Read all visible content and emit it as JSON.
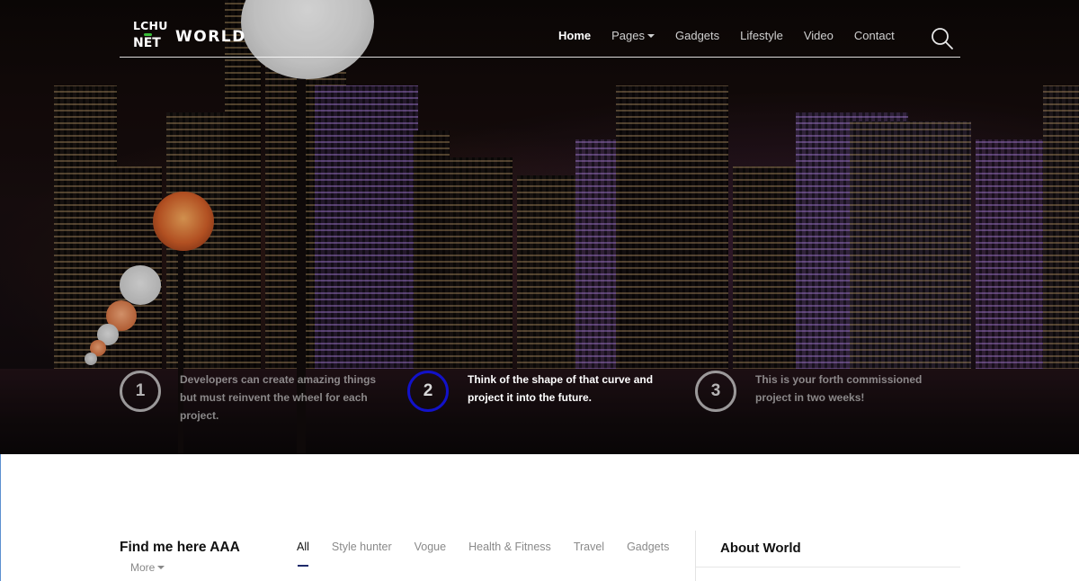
{
  "brand": {
    "logo_line1": "LCHU",
    "logo_line2": "NET",
    "name": "WORLD",
    "accent_color": "#3bbf3b"
  },
  "nav": {
    "items": [
      {
        "label": "Home",
        "active": true
      },
      {
        "label": "Pages",
        "dropdown": true
      },
      {
        "label": "Gadgets"
      },
      {
        "label": "Video"
      },
      {
        "label": "Contact"
      }
    ],
    "lifestyle_label": "Lifestyle",
    "search_icon": "search-icon"
  },
  "steps": [
    {
      "number": "1",
      "text": "Developers can create amazing things but must reinvent the wheel for each project.",
      "active": false
    },
    {
      "number": "2",
      "text": "Think of the shape of that curve and project it into the future.",
      "active": true
    },
    {
      "number": "3",
      "text": "This is your forth commissioned project in two weeks!",
      "active": false
    }
  ],
  "active_step_color": "#1212c9",
  "section": {
    "title": "Find me here AAA",
    "more_label": "More",
    "tabs": [
      "All",
      "Style hunter",
      "Vogue",
      "Health & Fitness",
      "Travel",
      "Gadgets"
    ],
    "active_tab": "All"
  },
  "sidebar": {
    "title": "About World"
  }
}
